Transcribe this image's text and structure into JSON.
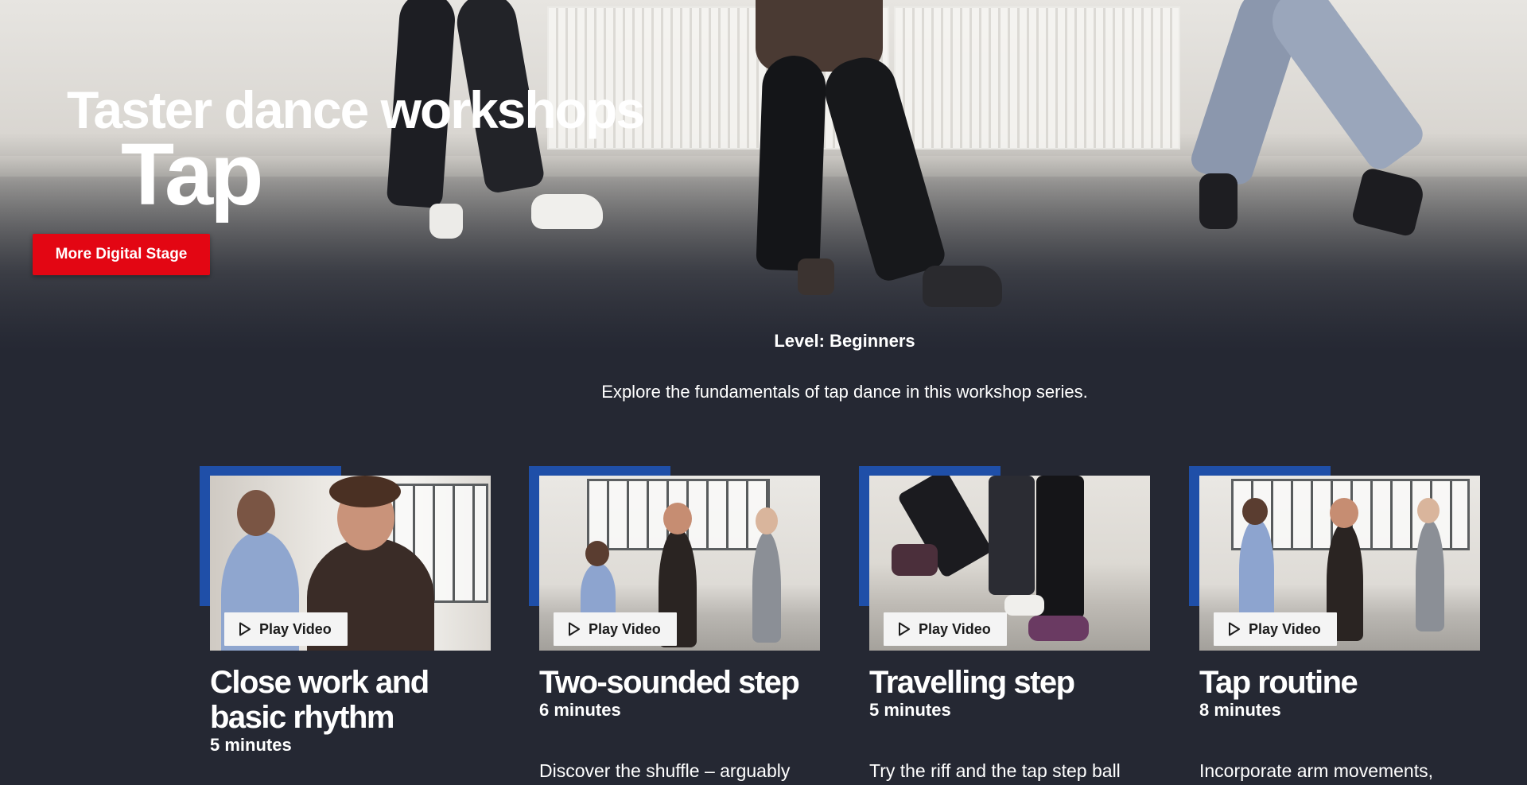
{
  "hero": {
    "title": "Taster dance workshops",
    "subtitle": "Tap",
    "cta_label": "More Digital Stage"
  },
  "intro": {
    "level": "Level: Beginners",
    "description": "Explore the fundamentals of tap dance in this workshop series."
  },
  "cards": [
    {
      "title": "Close work and basic rhythm",
      "duration": "5 minutes",
      "play_label": "Play Video",
      "description": ""
    },
    {
      "title": "Two-sounded step",
      "duration": "6 minutes",
      "play_label": "Play Video",
      "description": "Discover the shuffle – arguably"
    },
    {
      "title": "Travelling step",
      "duration": "5 minutes",
      "play_label": "Play Video",
      "description": "Try the riff and the tap step ball"
    },
    {
      "title": "Tap routine",
      "duration": "8 minutes",
      "play_label": "Play Video",
      "description": "Incorporate arm movements,"
    }
  ],
  "colors": {
    "background": "#252833",
    "accent_red": "#e30613",
    "frame_blue": "#1f4fa8"
  },
  "icons": [
    "play-icon"
  ]
}
